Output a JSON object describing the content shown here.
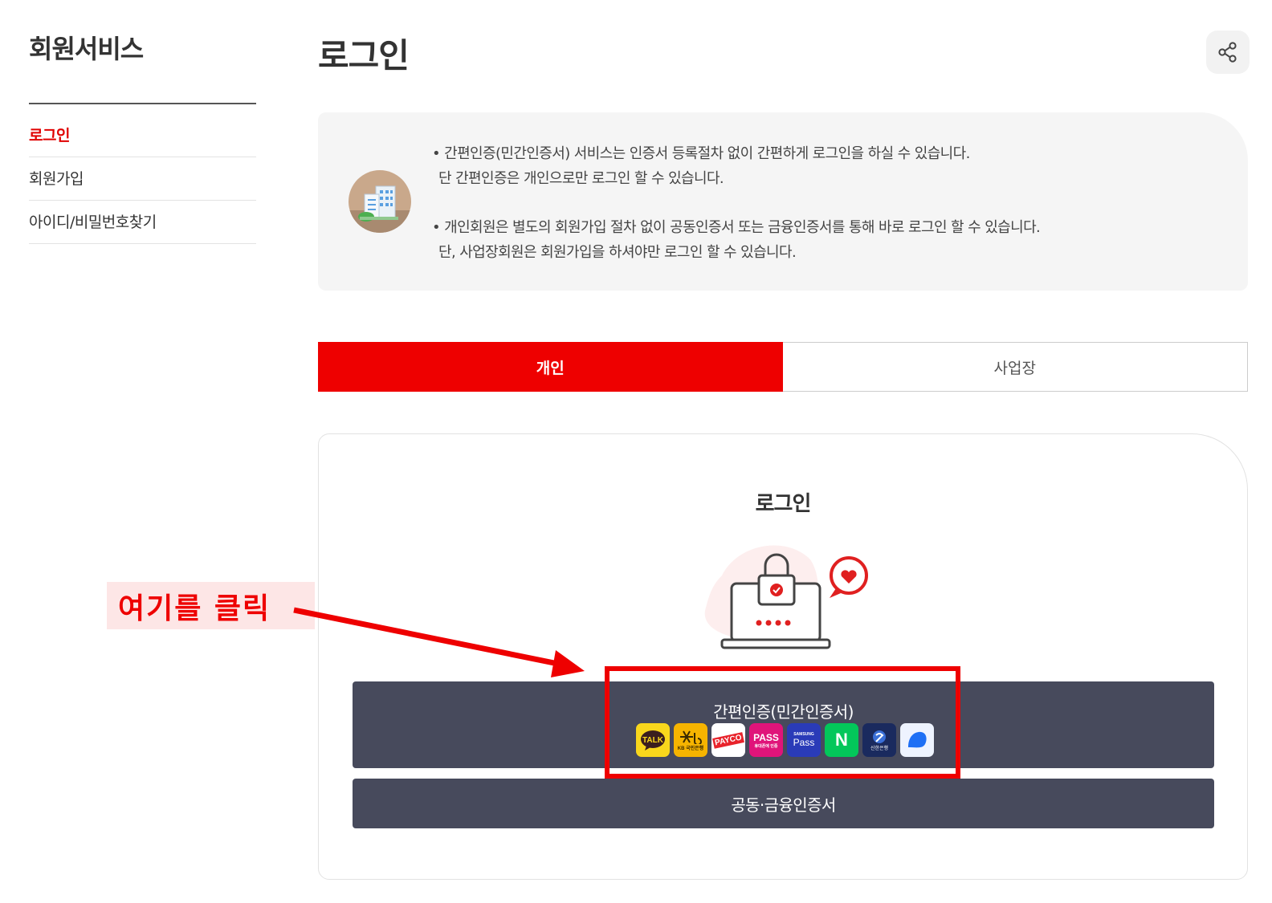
{
  "sidebar": {
    "title": "회원서비스",
    "items": [
      {
        "label": "로그인",
        "active": true
      },
      {
        "label": "회원가입",
        "active": false
      },
      {
        "label": "아이디/비밀번호찾기",
        "active": false
      }
    ]
  },
  "header": {
    "title": "로그인",
    "share_icon": "share-icon"
  },
  "info": {
    "icon": "building-icon",
    "lines": [
      "• 간편인증(민간인증서) 서비스는 인증서 등록절차 없이 간편하게 로그인을 하실 수 있습니다.",
      "단 간편인증은 개인으로만 로그인 할 수 있습니다.",
      "• 개인회원은 별도의 회원가입 절차 없이 공동인증서 또는 금융인증서를 통해 바로 로그인 할 수 있습니다.",
      "단, 사업장회원은 회원가입을 하셔야만 로그인 할 수 있습니다."
    ]
  },
  "tabs": [
    {
      "label": "개인",
      "active": true
    },
    {
      "label": "사업장",
      "active": false
    }
  ],
  "login": {
    "heading": "로그인",
    "simple_auth_label": "간편인증(민간인증서)",
    "providers": [
      {
        "name": "kakaotalk",
        "text": "TALK",
        "bg": "#f9d71c"
      },
      {
        "name": "kb",
        "text": "KB 국민은행",
        "bg": "#f6b400"
      },
      {
        "name": "payco",
        "text": "PAYCO",
        "bg": "#ffffff"
      },
      {
        "name": "pass",
        "text": "PASS",
        "sub": "휴대폰에 인증",
        "bg": "#e0147a"
      },
      {
        "name": "samsung-pass",
        "text": "Pass",
        "sub": "SAMSUNG",
        "bg": "#2a3bb8"
      },
      {
        "name": "naver",
        "text": "N",
        "bg": "#03c75a"
      },
      {
        "name": "shinhan",
        "text": "신한은행",
        "bg": "#1a2a5e"
      },
      {
        "name": "toss",
        "text": "",
        "bg": "#eef3ff"
      }
    ],
    "cert_label": "공동·금융인증서"
  },
  "annotation": {
    "callout_text": "여기를 클릭",
    "color": "#ee0000"
  },
  "colors": {
    "accent": "#ee0000",
    "button": "#474a5c",
    "info_bg": "#f5f5f5"
  }
}
